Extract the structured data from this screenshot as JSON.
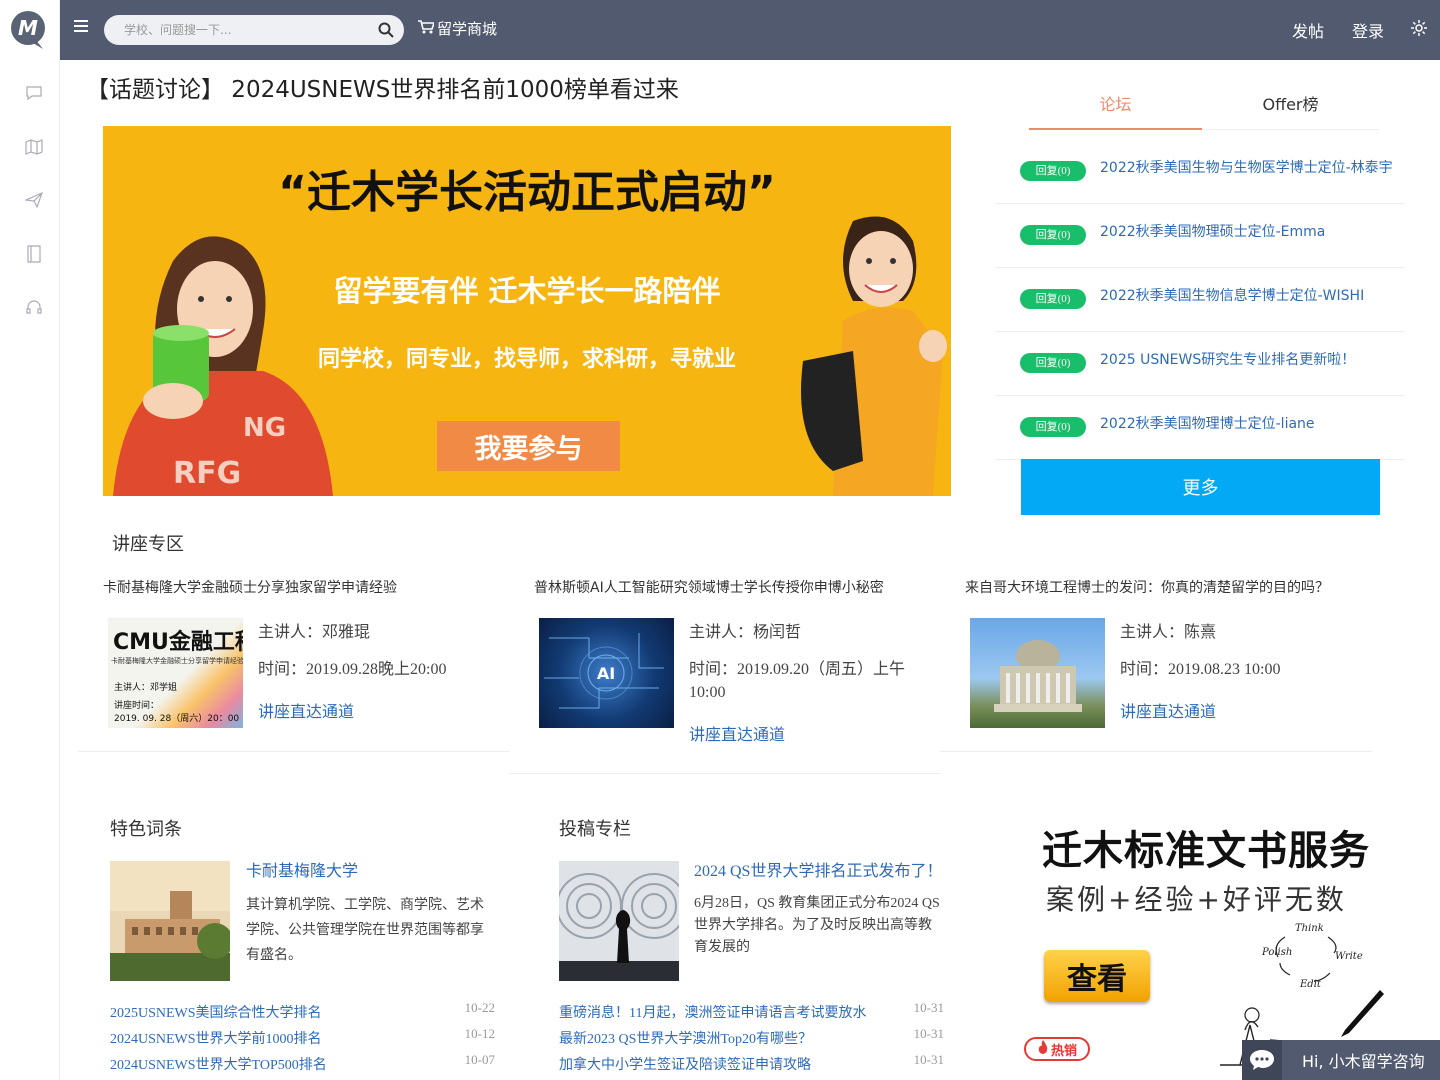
{
  "search": {
    "placeholder": "学校、问题搜一下..."
  },
  "topbar": {
    "mall_label": "留学商城",
    "post_label": "发帖",
    "login_label": "登录"
  },
  "topic_title": "【话题讨论】 2024USNEWS世界排名前1000榜单看过来",
  "banner": {
    "headline": "“迁木学长活动正式启动”",
    "subline": "留学要有伴 迁木学长一路陪伴",
    "features": "同学校，同专业，找导师，求科研，寻就业",
    "cta": "我要参与",
    "shirt_text_1": "NG",
    "shirt_text_2": "RFG"
  },
  "tabs": [
    {
      "label": "论坛"
    },
    {
      "label": "Offer榜"
    }
  ],
  "forum_items": [
    {
      "badge": "回复(0)",
      "title": "2022秋季美国生物与生物医学博士定位-林泰宇"
    },
    {
      "badge": "回复(0)",
      "title": "2022秋季美国物理硕士定位-Emma"
    },
    {
      "badge": "回复(0)",
      "title": "2022秋季美国生物信息学博士定位-WISHI"
    },
    {
      "badge": "回复(0)",
      "title": "2025 USNEWS研究生专业排名更新啦！"
    },
    {
      "badge": "回复(0)",
      "title": "2022秋季美国物理博士定位-liane"
    }
  ],
  "more_label": "更多",
  "lecture_heading": "讲座专区",
  "lectures": [
    {
      "title": "卡耐基梅隆大学金融硕士分享独家留学申请经验",
      "speaker": "主讲人：邓雅琨",
      "time": "时间：2019.09.28晚上20:00",
      "link": "讲座直达通道",
      "img_title": "CMU金融工程",
      "img_sub": "卡耐基梅隆大学金融硕士分享留学申请经验",
      "img_speaker": "主讲人：邓学姐",
      "img_time_label": "讲座时间：",
      "img_time": "2019. 09. 28（周六）20：00"
    },
    {
      "title": "普林斯顿AI人工智能研究领域博士学长传授你申博小秘密",
      "speaker": "主讲人：杨闰哲",
      "time": "时间：2019.09.20（周五）上午10:00",
      "link": "讲座直达通道",
      "img_badge": "AI"
    },
    {
      "title": "来自哥大环境工程博士的发问：你真的清楚留学的目的吗？",
      "speaker": "主讲人：陈熹",
      "time": "时间：2019.08.23 10:00",
      "link": "讲座直达通道"
    }
  ],
  "featured": {
    "heading": "特色词条",
    "link": "卡耐基梅隆大学",
    "desc": "其计算机学院、工学院、商学院、艺术学院、公共管理学院在世界范围等都享有盛名。",
    "news": [
      {
        "text": "2025USNEWS美国综合性大学排名",
        "date": "10-22"
      },
      {
        "text": "2024USNEWS世界大学前1000排名",
        "date": "10-12"
      },
      {
        "text": "2024USNEWS世界大学TOP500排名",
        "date": "10-07"
      }
    ]
  },
  "submissions": {
    "heading": "投稿专栏",
    "link": "2024 QS世界大学排名正式发布了！",
    "desc": "6月28日，QS 教育集团正式分布2024 QS世界大学排名。为了及时反映出高等教育发展的",
    "news": [
      {
        "text": "重磅消息！11月起，澳洲签证申请语言考试要放水",
        "date": "10-31"
      },
      {
        "text": "最新2023 QS世界大学澳洲Top20有哪些？",
        "date": "10-31"
      },
      {
        "text": "加拿大中小学生签证及陪读签证申请攻略",
        "date": "10-31"
      }
    ]
  },
  "ad": {
    "title": "迁木标准文书服务",
    "subtitle": "案例+经验+好评无数",
    "button": "查看",
    "hot": "热销",
    "sketch_words": [
      "Think",
      "Polish",
      "Write",
      "Edit"
    ]
  },
  "chat": {
    "label": "Hi, 小木留学咨询"
  },
  "colors": {
    "topbar": "#515a6e",
    "accent": "#ee8a66",
    "link": "#2d6bb8",
    "badge": "#19be6b",
    "more": "#03a9f4",
    "banner": "#f7b511"
  }
}
